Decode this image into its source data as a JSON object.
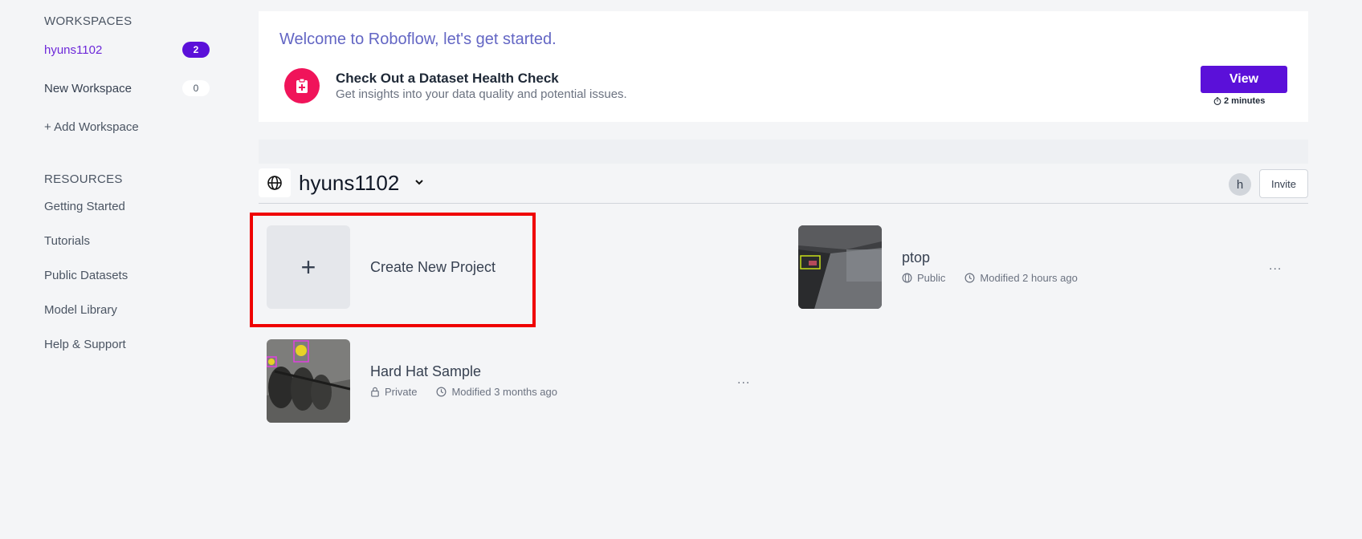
{
  "sidebar": {
    "workspaces_heading": "WORKSPACES",
    "workspaces": [
      {
        "name": "hyuns1102",
        "count": "2",
        "active": true
      },
      {
        "name": "New Workspace",
        "count": "0",
        "active": false
      }
    ],
    "add_workspace": "+ Add Workspace",
    "resources_heading": "RESOURCES",
    "resources": [
      "Getting Started",
      "Tutorials",
      "Public Datasets",
      "Model Library",
      "Help & Support"
    ]
  },
  "banner": {
    "title": "Welcome to Roboflow, let's get started.",
    "heading": "Check Out a Dataset Health Check",
    "subtitle": "Get insights into your data quality and potential issues.",
    "button_label": "View",
    "duration": "2 minutes",
    "icon": "clipboard-plus-icon",
    "accent_color": "#f0145a",
    "button_color": "#5b10d9"
  },
  "workspace": {
    "name": "hyuns1102",
    "avatar_initial": "h",
    "invite_label": "Invite"
  },
  "projects": {
    "create_label": "Create New Project",
    "items": [
      {
        "name": "ptop",
        "visibility": "Public",
        "modified": "Modified 2 hours ago"
      },
      {
        "name": "Hard Hat Sample",
        "visibility": "Private",
        "modified": "Modified 3 months ago"
      }
    ],
    "more_label": "..."
  }
}
